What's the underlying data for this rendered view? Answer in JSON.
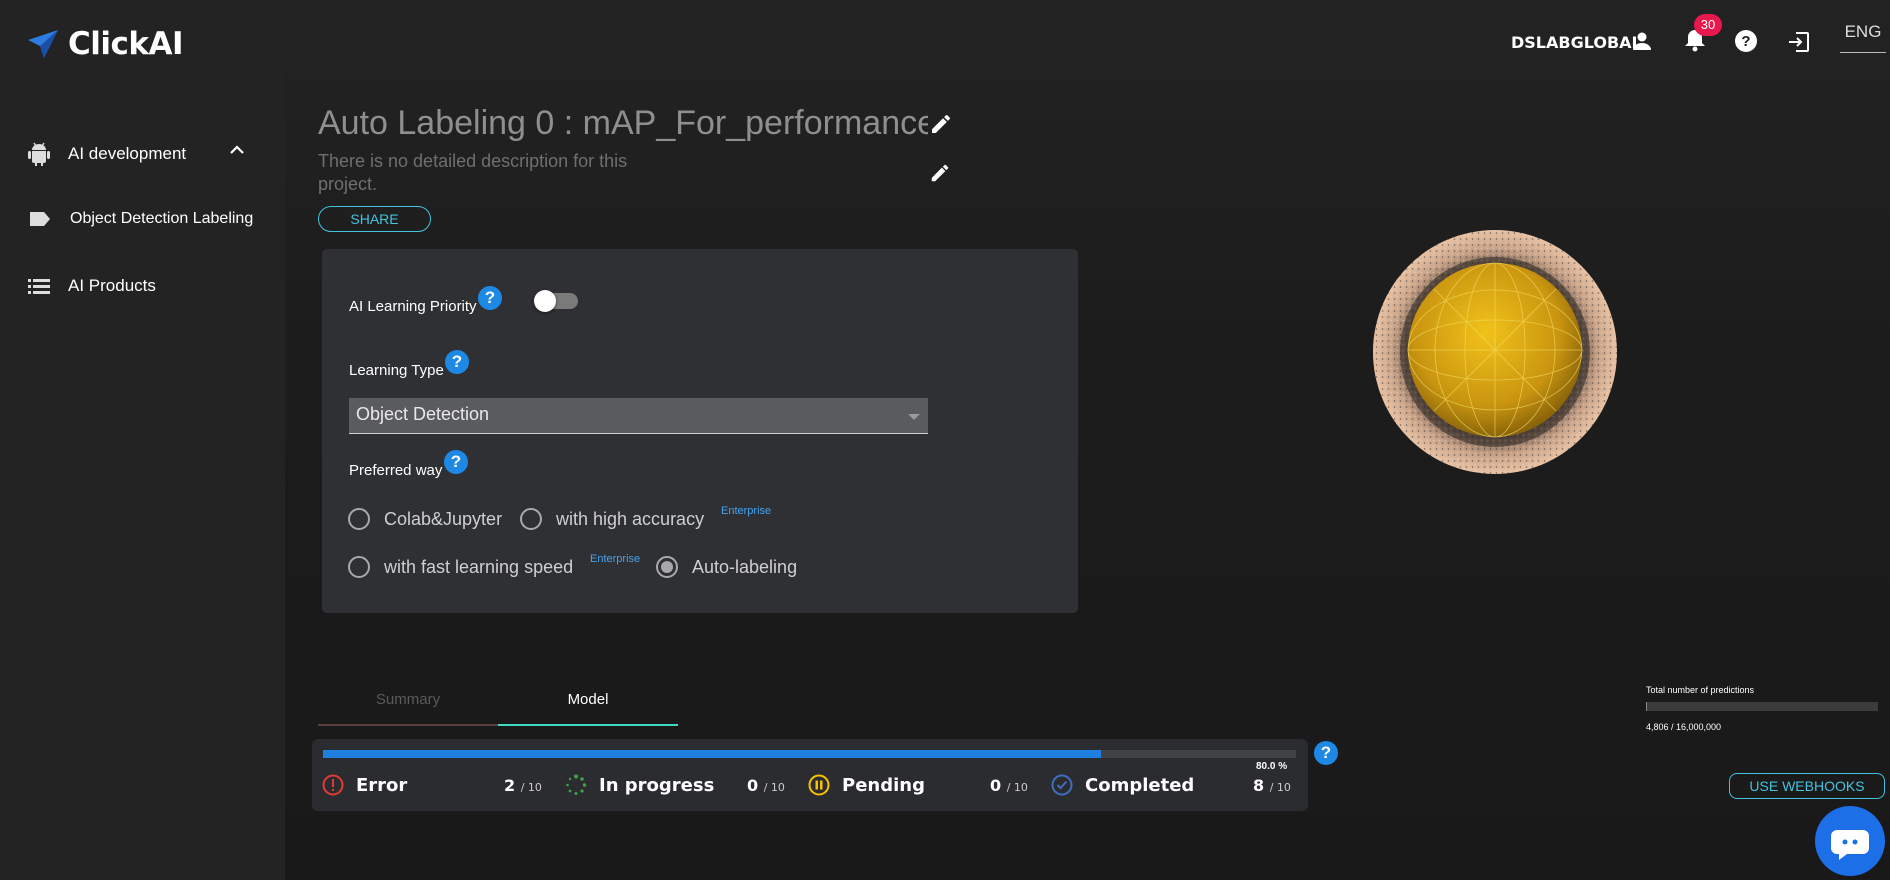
{
  "app": {
    "name": "ClickAI"
  },
  "sidebar": {
    "items": [
      {
        "label": "AI development",
        "icon": "android-icon",
        "expanded": true
      },
      {
        "label": "Object Detection Labeling",
        "icon": "label-icon"
      },
      {
        "label": "AI Products",
        "icon": "list-icon"
      }
    ]
  },
  "header": {
    "username": "DSLABGLOBAL",
    "notification_count": "30",
    "language": "ENG"
  },
  "project": {
    "title": "Auto Labeling 0 : mAP_For_performance",
    "description": "There is no detailed description for this project.",
    "share_label": "SHARE"
  },
  "settings": {
    "priority_label": "AI Learning Priority",
    "priority_enabled": false,
    "learning_type_label": "Learning Type",
    "learning_type_value": "Object Detection",
    "preferred_way_label": "Preferred way",
    "options": [
      {
        "label": "Colab&Jupyter",
        "selected": false
      },
      {
        "label": "with high accuracy",
        "selected": false,
        "tag": "Enterprise"
      },
      {
        "label": "with fast learning speed",
        "selected": false,
        "tag": "Enterprise"
      },
      {
        "label": "Auto-labeling",
        "selected": true
      }
    ],
    "help_glyph": "?"
  },
  "tabs": [
    {
      "label": "Summary",
      "active": false
    },
    {
      "label": "Model",
      "active": true
    }
  ],
  "progress": {
    "percent_text": "80.0 %",
    "fraction": 0.8,
    "statuses": [
      {
        "name": "Error",
        "count": "2",
        "total": "/ 10",
        "icon": "error-icon",
        "color": "#e53935"
      },
      {
        "name": "In progress",
        "count": "0",
        "total": "/ 10",
        "icon": "spinner-icon",
        "color": "#43a047"
      },
      {
        "name": "Pending",
        "count": "0",
        "total": "/ 10",
        "icon": "pause-icon",
        "color": "#f9c200"
      },
      {
        "name": "Completed",
        "count": "8",
        "total": "/ 10",
        "icon": "check-icon",
        "color": "#1e5fb5"
      }
    ]
  },
  "predictions": {
    "label": "Total number of predictions",
    "value": "4,806 / 16,000,000",
    "fraction": 0.0003
  },
  "webhooks_label": "USE WEBHOOKS",
  "colors": {
    "accent": "#43c3e0",
    "primary": "#1e88e5",
    "tab_active": "#3fd9c0",
    "badge": "#e8174c"
  }
}
